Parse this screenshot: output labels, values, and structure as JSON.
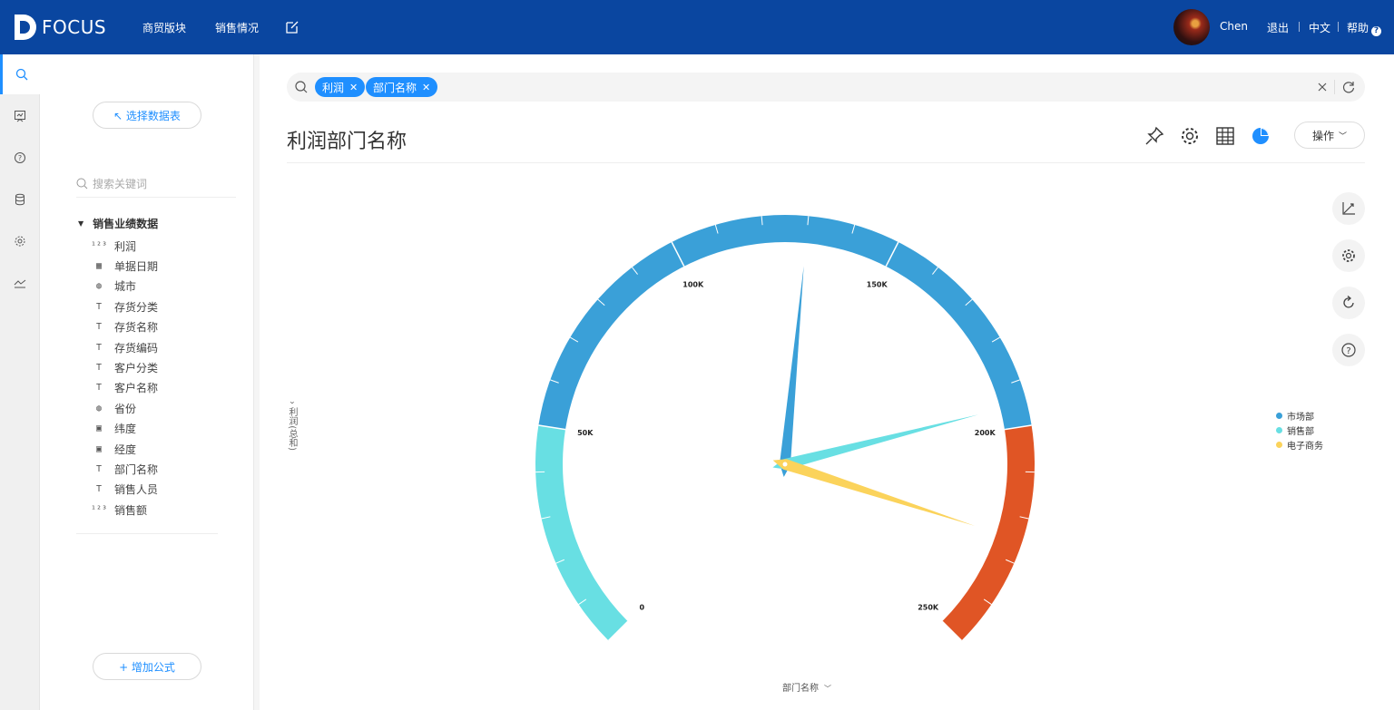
{
  "app": {
    "logo": "FOCUS"
  },
  "nav": {
    "items": [
      "商贸版块",
      "销售情况"
    ]
  },
  "user": {
    "name": "Chen",
    "logout": "退出",
    "lang": "中文",
    "help": "帮助"
  },
  "panel": {
    "select_table": "↖ 选择数据表",
    "search_placeholder": "搜索关键词",
    "table_name": "销售业绩数据",
    "fields": [
      {
        "label": "利润",
        "icon": "number-icon"
      },
      {
        "label": "单据日期",
        "icon": "calendar-icon"
      },
      {
        "label": "城市",
        "icon": "globe-icon"
      },
      {
        "label": "存货分类",
        "icon": "text-icon"
      },
      {
        "label": "存货名称",
        "icon": "text-icon"
      },
      {
        "label": "存货编码",
        "icon": "text-icon"
      },
      {
        "label": "客户分类",
        "icon": "text-icon"
      },
      {
        "label": "客户名称",
        "icon": "text-icon"
      },
      {
        "label": "省份",
        "icon": "globe-icon"
      },
      {
        "label": "纬度",
        "icon": "geo-icon"
      },
      {
        "label": "经度",
        "icon": "geo-icon"
      },
      {
        "label": "部门名称",
        "icon": "text-icon"
      },
      {
        "label": "销售人员",
        "icon": "text-icon"
      },
      {
        "label": "销售额",
        "icon": "number-icon"
      }
    ],
    "add_formula": "+ 增加公式"
  },
  "search": {
    "chips": [
      "利润",
      "部门名称"
    ]
  },
  "main": {
    "title": "利润部门名称",
    "ops_label": "操作"
  },
  "chart_data": {
    "type": "gauge",
    "title": "利润部门名称",
    "xlabel": "部门名称",
    "ylabel": "利润(总和)",
    "range": [
      0,
      250000
    ],
    "major_ticks": [
      "0",
      "50K",
      "100K",
      "150K",
      "200K",
      "250K"
    ],
    "bands": [
      {
        "from": 0,
        "to": 50000,
        "color": "#68dfe3"
      },
      {
        "from": 50000,
        "to": 200000,
        "color": "#3aa0d8"
      },
      {
        "from": 200000,
        "to": 250000,
        "color": "#e05525"
      }
    ],
    "series": [
      {
        "name": "市场部",
        "value": 130000,
        "color": "#3aa0d8"
      },
      {
        "name": "销售部",
        "value": 195000,
        "color": "#68dfe3"
      },
      {
        "name": "电子商务",
        "value": 225000,
        "color": "#fbd35b"
      }
    ]
  }
}
